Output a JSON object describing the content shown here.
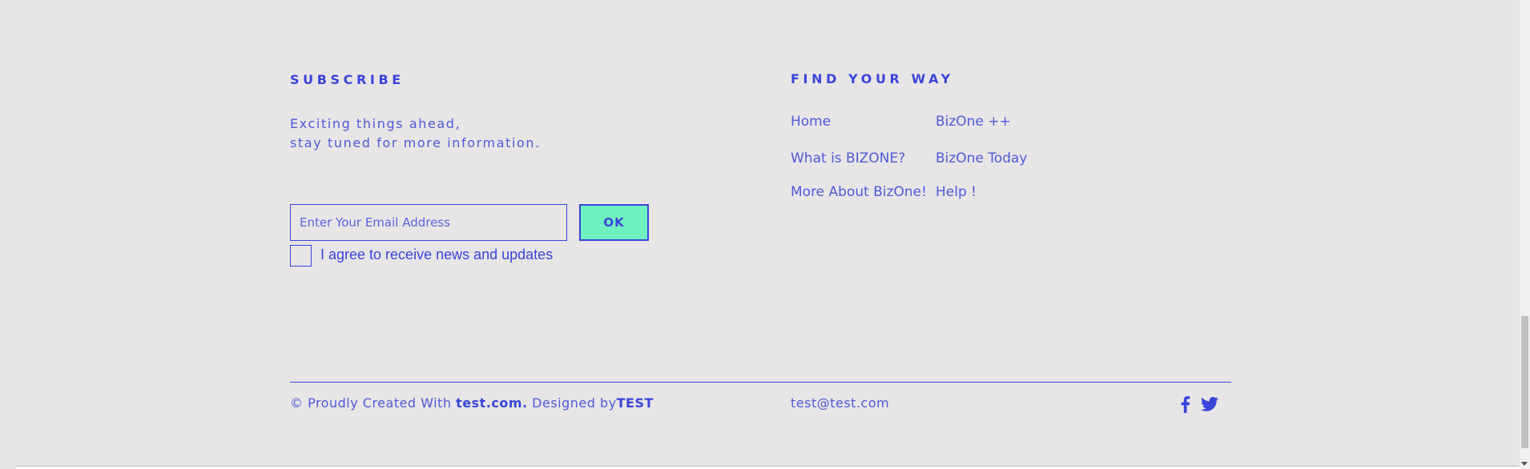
{
  "subscribe": {
    "heading": "SUBSCRIBE",
    "tagline_line1": "Exciting things ahead,",
    "tagline_line2": "stay tuned for more information.",
    "email_placeholder": "Enter Your Email Address",
    "email_value": "",
    "ok_label": "OK",
    "agree_checked": false,
    "agree_label": "I agree to receive news and updates"
  },
  "find_your_way": {
    "heading": "FIND YOUR WAY",
    "links": [
      "Home",
      "BizOne ++",
      "What is BIZONE?",
      "BizOne Today",
      "More About BizOne!",
      "Help !"
    ]
  },
  "footer": {
    "credit_prefix": "© Proudly Created With ",
    "credit_site": "test.com.",
    "credit_middle": " Designed by",
    "credit_designer": "TEST",
    "email": "test@test.com",
    "social": [
      {
        "name": "facebook-icon"
      },
      {
        "name": "twitter-icon"
      }
    ]
  },
  "colors": {
    "background": "#e7e5e6",
    "accent": "#3a45d9",
    "button": "#6ff0c0"
  }
}
